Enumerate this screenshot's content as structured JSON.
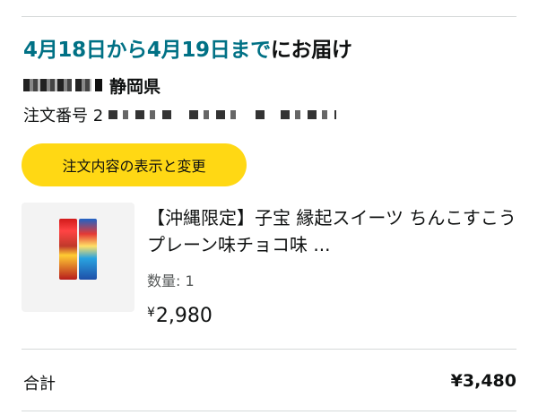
{
  "delivery": {
    "range": "4月18日から4月19日まで",
    "suffix": "にお届け"
  },
  "address": {
    "prefecture": "静岡県"
  },
  "order": {
    "number_label": "注文番号 2"
  },
  "actions": {
    "view_edit_label": "注文内容の表示と変更"
  },
  "item": {
    "title": "【沖縄限定】子宝 縁起スイーツ ちんこすこう プレーン味チョコ味 ...",
    "quantity_label": "数量: 1",
    "price_symbol": "¥",
    "price_value": "2,980"
  },
  "summary": {
    "total_label": "合計",
    "total_value": "¥3,480"
  },
  "colors": {
    "accent_link": "#007185",
    "button_yellow": "#ffd814"
  }
}
